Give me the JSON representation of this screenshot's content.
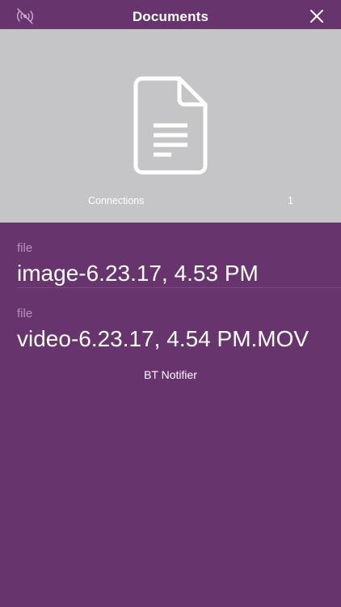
{
  "header": {
    "title": "Documents",
    "left_icon": "broadcast-icon",
    "close_icon": "close-icon"
  },
  "preview": {
    "icon": "document-icon",
    "connections_label": "Connections",
    "connections_count": "1"
  },
  "files": [
    {
      "type": "file",
      "name": "image-6.23.17, 4.53 PM"
    },
    {
      "type": "file",
      "name": "video-6.23.17, 4.54 PM.MOV"
    }
  ],
  "footer": {
    "text": "BT Notifier"
  },
  "colors": {
    "background": "#68346e",
    "preview_background": "#c5c5c7",
    "file_type_text": "#b593b9"
  }
}
